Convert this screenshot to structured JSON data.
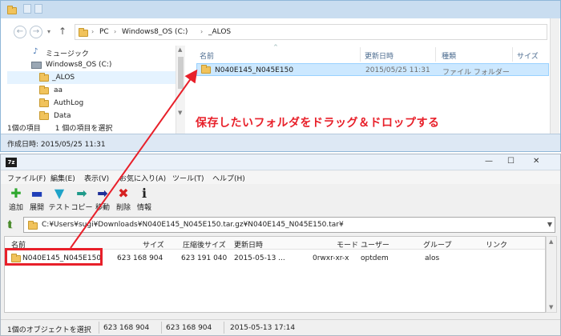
{
  "explorer": {
    "address": {
      "crumbs": [
        "PC",
        "Windows8_OS (C:)",
        "_ALOS"
      ]
    },
    "tree": {
      "items": [
        {
          "label": "ミュージック"
        },
        {
          "label": "Windows8_OS (C:)"
        },
        {
          "label": "_ALOS"
        },
        {
          "label": "aa"
        },
        {
          "label": "AuthLog"
        },
        {
          "label": "Data"
        }
      ]
    },
    "columns": [
      "名前",
      "更新日時",
      "種類",
      "サイズ"
    ],
    "files": [
      {
        "name": "N040E145_N045E150",
        "modified": "2015/05/25 11:31",
        "type": "ファイル フォルダー"
      }
    ],
    "status": "1個の項目　　1 個の項目を選択",
    "detail": "作成日時: 2015/05/25 11:31"
  },
  "sevenzip": {
    "logo": "7z",
    "menu": [
      "ファイル(F)",
      "編集(E)",
      "表示(V)",
      "お気に入り(A)",
      "ツール(T)",
      "ヘルプ(H)"
    ],
    "toolbar": [
      {
        "label": "追加",
        "icon": "plus-icon",
        "glyph": "✚",
        "color": "#2fa82f"
      },
      {
        "label": "展開",
        "icon": "minus-icon",
        "glyph": "▬",
        "color": "#1f3fb8"
      },
      {
        "label": "テスト",
        "icon": "check-icon",
        "glyph": "▼",
        "color": "#1fa3c8"
      },
      {
        "label": "コピー",
        "icon": "copy-arrow-icon",
        "glyph": "➡",
        "color": "#1f9a8a"
      },
      {
        "label": "移動",
        "icon": "move-arrow-icon",
        "glyph": "➡",
        "color": "#1f2f98"
      },
      {
        "label": "削除",
        "icon": "delete-x-icon",
        "glyph": "✖",
        "color": "#d62020"
      },
      {
        "label": "情報",
        "icon": "info-icon",
        "glyph": "ℹ",
        "color": "#222222"
      }
    ],
    "path": "C:¥Users¥sugi¥Downloads¥N040E145_N045E150.tar.gz¥N040E145_N045E150.tar¥",
    "columns": [
      "名前",
      "サイズ",
      "圧縮後サイズ",
      "更新日時",
      "モード",
      "ユーザー",
      "グループ",
      "リンク"
    ],
    "rows": [
      {
        "name": "N040E145_N045E150",
        "size": "623 168 904",
        "packed": "623 191 040",
        "modified": "2015-05-13 ...",
        "mode": "0rwxr-xr-x",
        "user": "optdem",
        "group": "alos"
      }
    ],
    "status": [
      "1個のオブジェクトを選択",
      "623 168 904",
      "623 168 904",
      "2015-05-13 17:14"
    ]
  },
  "annotation": {
    "text": "保存したいフォルダをドラッグ＆ドロップする",
    "color": "#e8202a"
  }
}
